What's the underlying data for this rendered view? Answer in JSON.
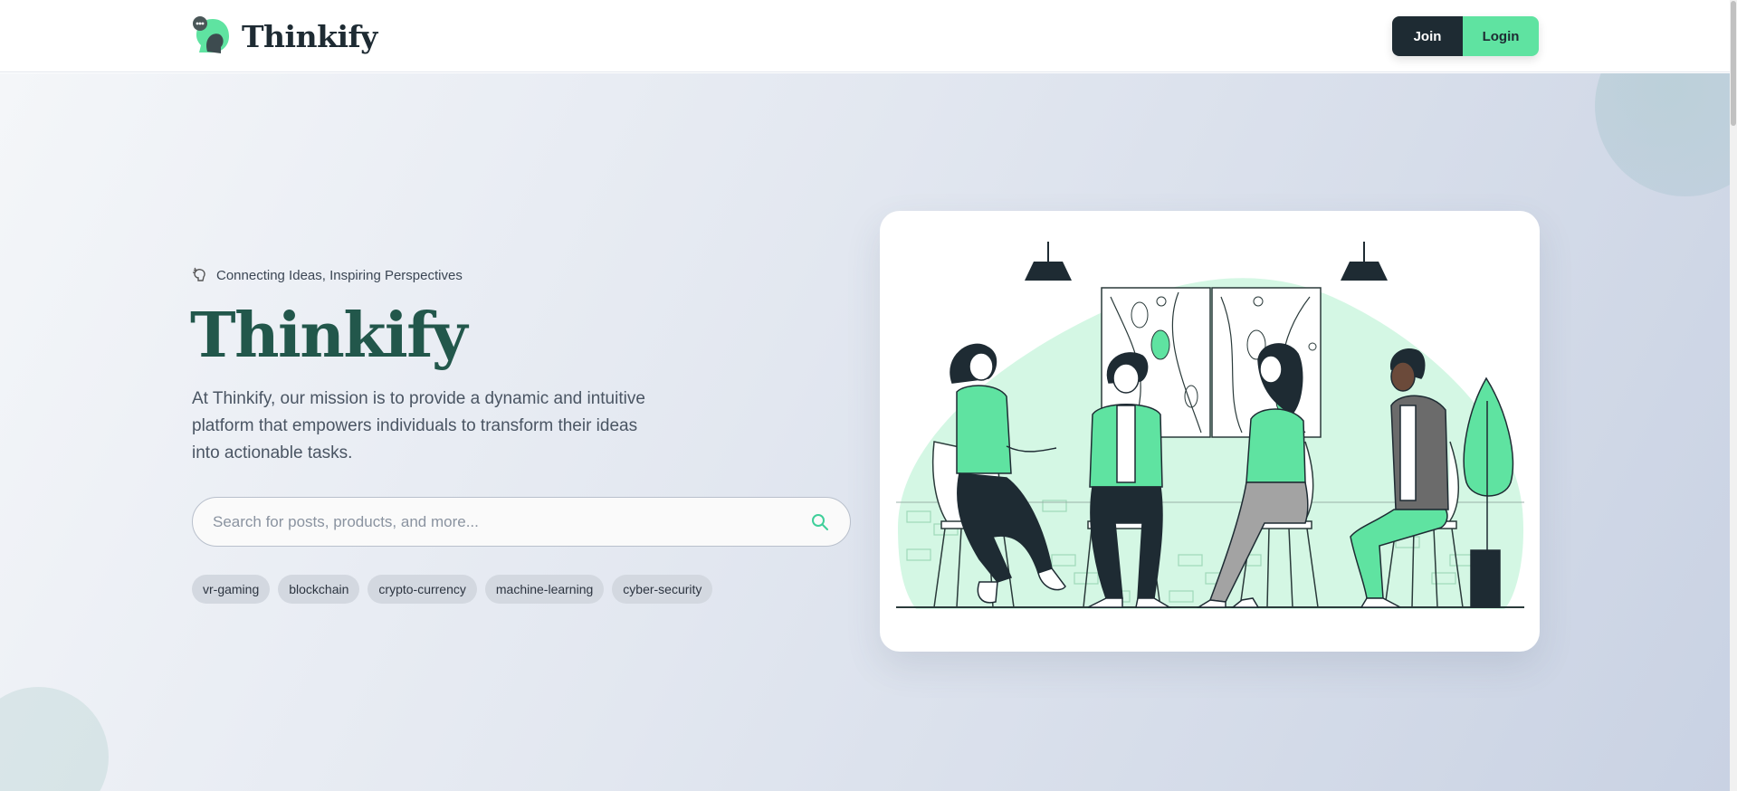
{
  "header": {
    "brand_name": "Thinkify",
    "join_label": "Join",
    "login_label": "Login"
  },
  "hero": {
    "tagline": "Connecting Ideas, Inspiring Perspectives",
    "title": "Thinkify",
    "mission": "At Thinkify, our mission is to provide a dynamic and intuitive platform that empowers individuals to transform their ideas into actionable tasks.",
    "search": {
      "placeholder": "Search for posts, products, and more...",
      "value": ""
    },
    "tags": [
      "vr-gaming",
      "blockchain",
      "crypto-currency",
      "machine-learning",
      "cyber-security"
    ]
  },
  "colors": {
    "brand_dark": "#1e2b33",
    "brand_green": "#5fe3a1",
    "title_green": "#22574b"
  },
  "icons": {
    "brand": "chat-bubble-head-icon",
    "tagline": "brain-waves-icon",
    "search": "search-icon"
  }
}
